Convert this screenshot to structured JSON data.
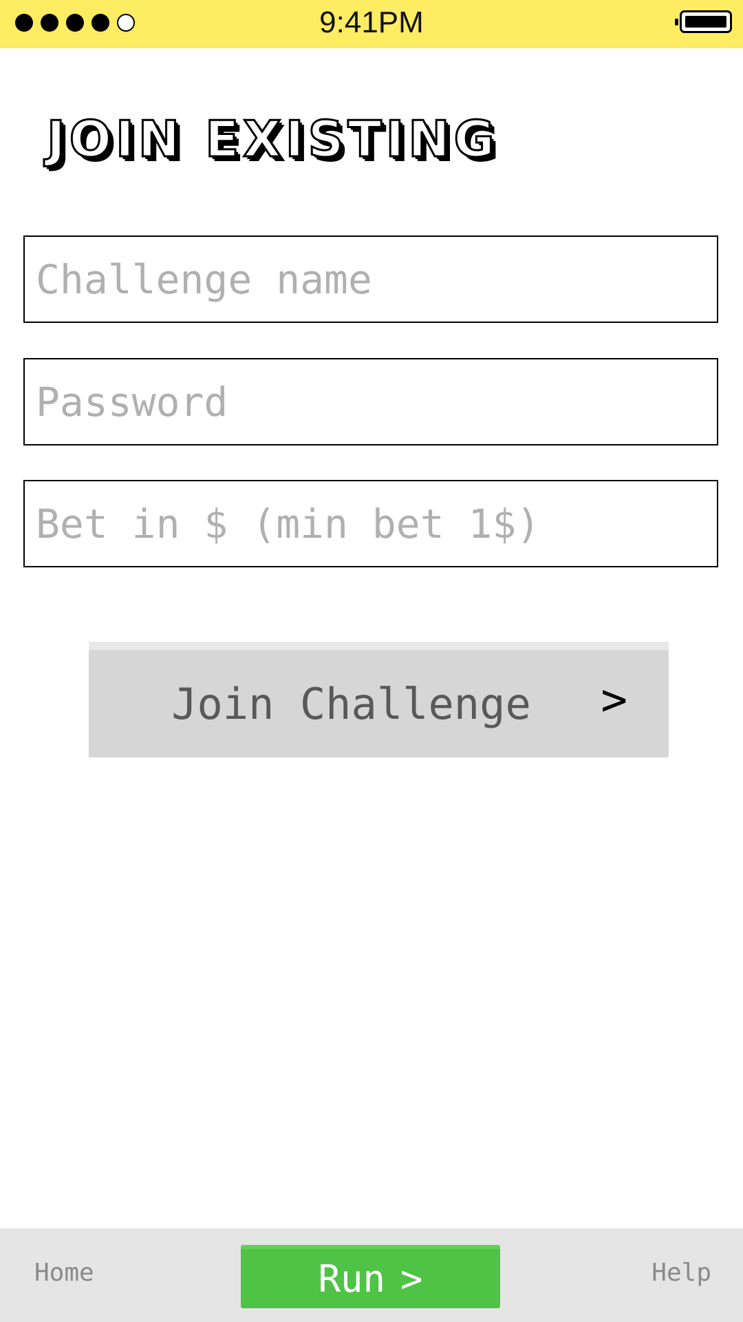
{
  "status_bar": {
    "time": "9:41PM",
    "signal_bars_filled": 4,
    "signal_bars_total": 5,
    "icons": [
      "signal-dots-icon",
      "battery-icon"
    ],
    "background_color": "#feec62"
  },
  "page": {
    "title": "JOIN EXISTING"
  },
  "form": {
    "challenge_name": {
      "placeholder": "Challenge name",
      "value": ""
    },
    "password": {
      "placeholder": "Password",
      "value": ""
    },
    "bet": {
      "placeholder": "Bet in $ (min bet 1$)",
      "value": ""
    }
  },
  "join_button": {
    "label": "Join Challenge",
    "chevron": ">",
    "icon": "chevron-right-icon"
  },
  "bottom_bar": {
    "home_label": "Home",
    "run_label": "Run",
    "run_chevron": ">",
    "help_label": "Help",
    "run_color": "#4fc346"
  }
}
